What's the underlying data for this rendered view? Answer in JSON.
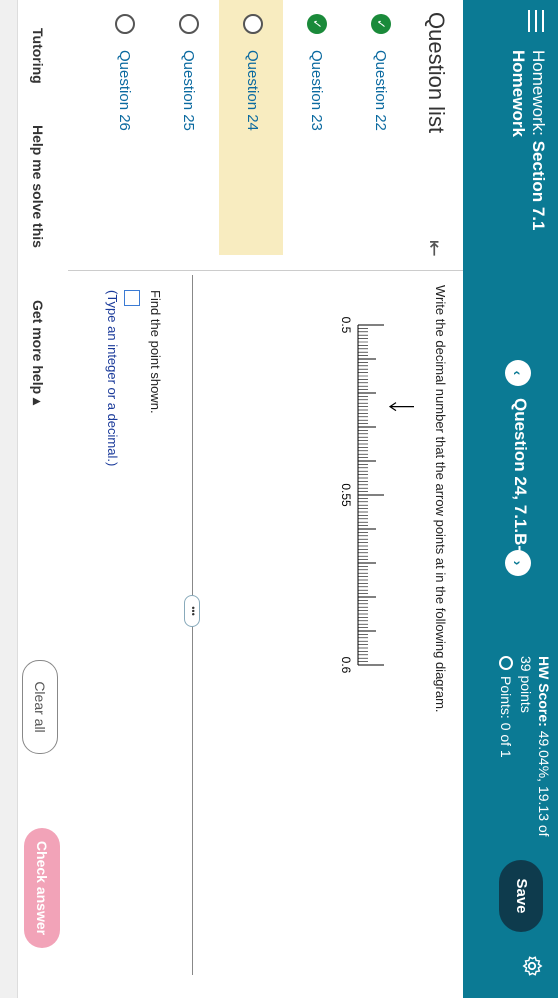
{
  "header": {
    "title_prefix": "Homework:",
    "title_section": "Section 7.1",
    "subtitle": "Homework",
    "question_title": "Question 24, 7.1.B-19",
    "hw_score_label": "HW Score:",
    "hw_score_value": "49.04%, 19.13 of",
    "hw_points": "39 points",
    "points_label": "Points: 0 of 1",
    "save_label": "Save",
    "prev_glyph": "‹",
    "next_glyph": "›"
  },
  "sidebar": {
    "title": "Question list",
    "collapse_glyph": "⇤",
    "items": [
      {
        "label": "Question 22",
        "status": "done"
      },
      {
        "label": "Question 23",
        "status": "done"
      },
      {
        "label": "Question 24",
        "status": "open",
        "active": true
      },
      {
        "label": "Question 25",
        "status": "open"
      },
      {
        "label": "Question 26",
        "status": "open"
      }
    ]
  },
  "question": {
    "prompt": "Write the decimal number that the arrow points at in the following diagram.",
    "find_text": "Find the point shown.",
    "hint": "(Type an integer or a decimal.)",
    "more_glyph": "•••",
    "ruler": {
      "labels": [
        "0.5",
        "0.55",
        "0.6"
      ],
      "start": 0.5,
      "end": 0.6,
      "minor_step": 0.001,
      "arrow_value": 0.524
    }
  },
  "bottom": {
    "tutoring": "Tutoring",
    "help": "Help me solve this",
    "more_help": "Get more help ▴",
    "clear": "Clear all",
    "check": "Check answer"
  },
  "icons": {
    "menu": "menu-icon",
    "gear": "gear-icon",
    "check": "check-icon"
  },
  "colors": {
    "header_bg": "#0b7a94",
    "save_bg": "#0e3b4d",
    "check_bg": "#f2a3b8",
    "active_bg": "#f8ecc0",
    "done_green": "#1a8a3a"
  }
}
